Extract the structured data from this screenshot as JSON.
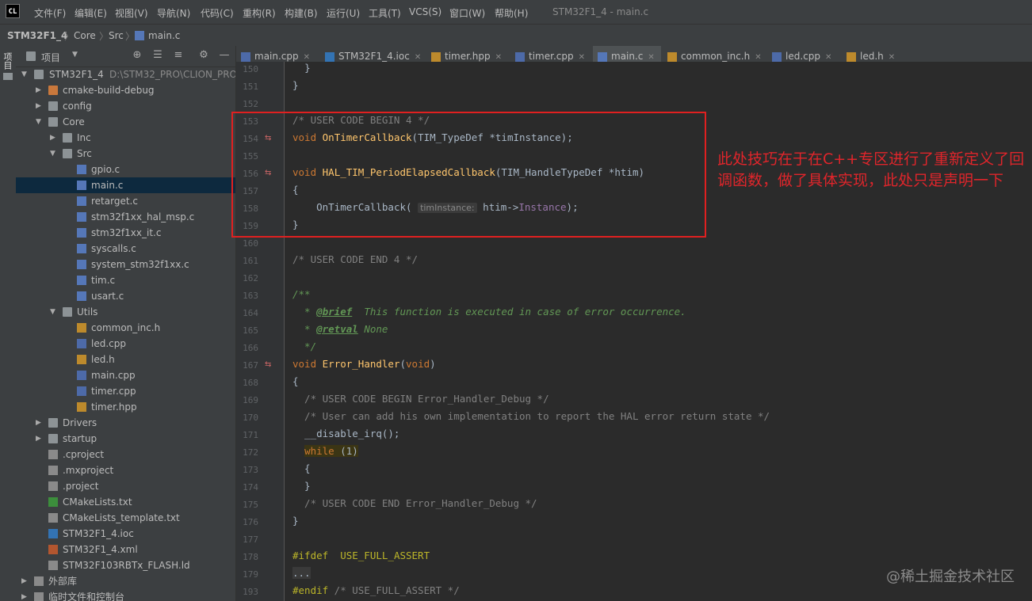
{
  "app": {
    "logo": "CL",
    "window_title": "STM32F1_4 - main.c"
  },
  "menu": [
    "文件(F)",
    "编辑(E)",
    "视图(V)",
    "导航(N)",
    "代码(C)",
    "重构(R)",
    "构建(B)",
    "运行(U)",
    "工具(T)",
    "VCS(S)",
    "窗口(W)",
    "帮助(H)"
  ],
  "breadcrumb": [
    "STM32F1_4",
    "Core",
    "Src",
    "main.c"
  ],
  "side_strip": {
    "label": "项目"
  },
  "project_panel": {
    "title": "项目",
    "root_label": "STM32F1_4",
    "root_path": "D:\\STM32_PRO\\CLION_PRO",
    "items": [
      {
        "label": "cmake-build-debug",
        "icon": "folder-orange"
      },
      {
        "label": "config",
        "icon": "folder"
      },
      {
        "label": "Core",
        "icon": "folder"
      },
      {
        "label": "Inc",
        "icon": "folder"
      },
      {
        "label": "Src",
        "icon": "folder"
      },
      {
        "label": "gpio.c",
        "icon": "c-file"
      },
      {
        "label": "main.c",
        "icon": "c-file"
      },
      {
        "label": "retarget.c",
        "icon": "c-file"
      },
      {
        "label": "stm32f1xx_hal_msp.c",
        "icon": "c-file"
      },
      {
        "label": "stm32f1xx_it.c",
        "icon": "c-file"
      },
      {
        "label": "syscalls.c",
        "icon": "c-file"
      },
      {
        "label": "system_stm32f1xx.c",
        "icon": "c-file"
      },
      {
        "label": "tim.c",
        "icon": "c-file"
      },
      {
        "label": "usart.c",
        "icon": "c-file"
      },
      {
        "label": "Utils",
        "icon": "folder"
      },
      {
        "label": "common_inc.h",
        "icon": "h-file"
      },
      {
        "label": "led.cpp",
        "icon": "cpp-file"
      },
      {
        "label": "led.h",
        "icon": "h-file"
      },
      {
        "label": "main.cpp",
        "icon": "cpp-file"
      },
      {
        "label": "timer.cpp",
        "icon": "cpp-file"
      },
      {
        "label": "timer.hpp",
        "icon": "h-file"
      },
      {
        "label": "Drivers",
        "icon": "folder"
      },
      {
        "label": "startup",
        "icon": "folder"
      },
      {
        "label": ".cproject",
        "icon": "generic-file"
      },
      {
        "label": ".mxproject",
        "icon": "generic-file"
      },
      {
        "label": ".project",
        "icon": "generic-file"
      },
      {
        "label": "CMakeLists.txt",
        "icon": "cmake-file"
      },
      {
        "label": "CMakeLists_template.txt",
        "icon": "generic-file"
      },
      {
        "label": "STM32F1_4.ioc",
        "icon": "ioc-file"
      },
      {
        "label": "STM32F1_4.xml",
        "icon": "xml-file"
      },
      {
        "label": "STM32F103RBTx_FLASH.ld",
        "icon": "generic-file"
      },
      {
        "label": "外部库",
        "icon": "library"
      },
      {
        "label": "临时文件和控制台",
        "icon": "scratch"
      }
    ]
  },
  "tabs": [
    {
      "label": "main.cpp",
      "icon": "cpp-file"
    },
    {
      "label": "STM32F1_4.ioc",
      "icon": "ioc-file"
    },
    {
      "label": "timer.hpp",
      "icon": "h-file"
    },
    {
      "label": "timer.cpp",
      "icon": "cpp-file"
    },
    {
      "label": "main.c",
      "icon": "c-file",
      "active": true
    },
    {
      "label": "common_inc.h",
      "icon": "h-file"
    },
    {
      "label": "led.cpp",
      "icon": "cpp-file"
    },
    {
      "label": "led.h",
      "icon": "h-file"
    }
  ],
  "line_numbers": [
    "150",
    "151",
    "152",
    "153",
    "154",
    "155",
    "156",
    "157",
    "158",
    "159",
    "160",
    "161",
    "162",
    "163",
    "164",
    "165",
    "166",
    "167",
    "168",
    "169",
    "170",
    "171",
    "172",
    "173",
    "174",
    "175",
    "176",
    "177",
    "178",
    "179",
    "193"
  ],
  "code": {
    "l150": "}",
    "l151": "}",
    "l153": "/* USER CODE BEGIN 4 */",
    "l154_kw": "void",
    "l154_fn": "OnTimerCallback",
    "l154_rest": "(TIM_TypeDef *timInstance);",
    "l156_kw": "void",
    "l156_fn": "HAL_TIM_PeriodElapsedCallback",
    "l156_rest": "(TIM_HandleTypeDef *htim)",
    "l157": "{",
    "l158_call": "OnTimerCallback(",
    "l158_hint": "timInstance:",
    "l158_arg": "htim->",
    "l158_field": "Instance",
    "l158_end": ");",
    "l159": "}",
    "l161": "/* USER CODE END 4 */",
    "l163": "/**",
    "l164_star": "  * ",
    "l164_tag": "@brief",
    "l164_text": "  This function is executed in case of error occurrence.",
    "l165_star": "  * ",
    "l165_tag": "@retval",
    "l165_text": " None",
    "l166": "  */",
    "l167_kw": "void",
    "l167_fn": "Error_Handler",
    "l167_rest1": "(",
    "l167_kw2": "void",
    "l167_rest2": ")",
    "l168": "{",
    "l169": "  /* USER CODE BEGIN Error_Handler_Debug */",
    "l170": "  /* User can add his own implementation to report the HAL error return state */",
    "l171": "  __disable_irq();",
    "l172_kw": "while",
    "l172_rest": " (1)",
    "l173": "  {",
    "l174": "  }",
    "l175": "  /* USER CODE END Error_Handler_Debug */",
    "l176": "}",
    "l178_pp": "#ifdef",
    "l178_rest": "  USE_FULL_ASSERT",
    "l179": "...",
    "l193_pp": "#endif",
    "l193_rest": " /* USE_FULL_ASSERT */"
  },
  "annotation": "此处技巧在于在C++专区进行了重新定义了回调函数，做了具体实现，此处只是声明一下",
  "watermark": "@稀土掘金技术社区"
}
